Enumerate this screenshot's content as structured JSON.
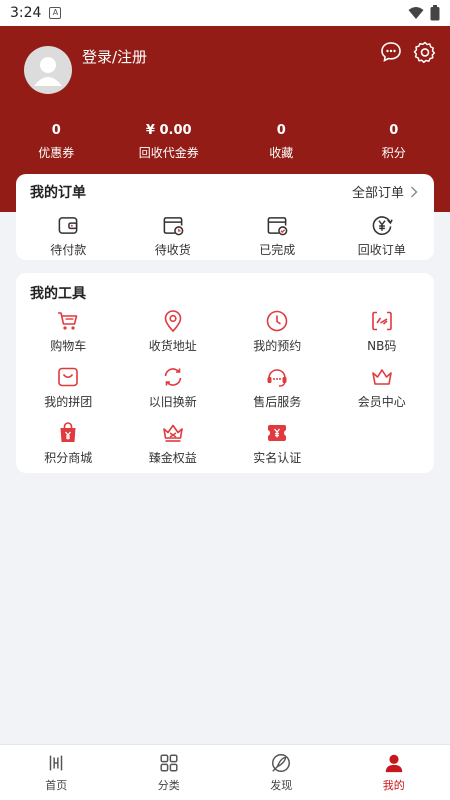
{
  "status_bar": {
    "time": "3:24",
    "notification_badge": "A"
  },
  "header": {
    "login_text": "登录/注册",
    "bg_color": "#931c16",
    "stats": [
      {
        "value": "0",
        "label": "优惠券"
      },
      {
        "value": "¥ 0.00",
        "label": "回收代金券"
      },
      {
        "value": "0",
        "label": "收藏"
      },
      {
        "value": "0",
        "label": "积分"
      }
    ]
  },
  "orders": {
    "title": "我的订单",
    "all_orders": "全部订单",
    "items": [
      {
        "label": "待付款",
        "icon": "wallet-icon"
      },
      {
        "label": "待收货",
        "icon": "package-clock-icon"
      },
      {
        "label": "已完成",
        "icon": "package-check-icon"
      },
      {
        "label": "回收订单",
        "icon": "yuan-recycle-icon"
      }
    ]
  },
  "tools": {
    "title": "我的工具",
    "items": [
      {
        "label": "购物车",
        "icon": "cart-icon"
      },
      {
        "label": "收货地址",
        "icon": "location-pin-icon"
      },
      {
        "label": "我的预约",
        "icon": "clock-icon"
      },
      {
        "label": "NB码",
        "icon": "nb-code-icon"
      },
      {
        "label": "我的拼团",
        "icon": "group-buy-icon"
      },
      {
        "label": "以旧换新",
        "icon": "trade-in-icon"
      },
      {
        "label": "售后服务",
        "icon": "headset-icon"
      },
      {
        "label": "会员中心",
        "icon": "crown-icon"
      },
      {
        "label": "积分商城",
        "icon": "points-bag-icon"
      },
      {
        "label": "臻金权益",
        "icon": "gold-crown-icon"
      },
      {
        "label": "实名认证",
        "icon": "id-verify-icon"
      }
    ]
  },
  "tabbar": {
    "items": [
      {
        "label": "首页",
        "icon": "home-logo-icon",
        "active": false
      },
      {
        "label": "分类",
        "icon": "category-grid-icon",
        "active": false
      },
      {
        "label": "发现",
        "icon": "discover-icon",
        "active": false
      },
      {
        "label": "我的",
        "icon": "profile-icon",
        "active": true
      }
    ]
  },
  "colors": {
    "accent": "#c8161d",
    "icon_red": "#e0393e"
  }
}
